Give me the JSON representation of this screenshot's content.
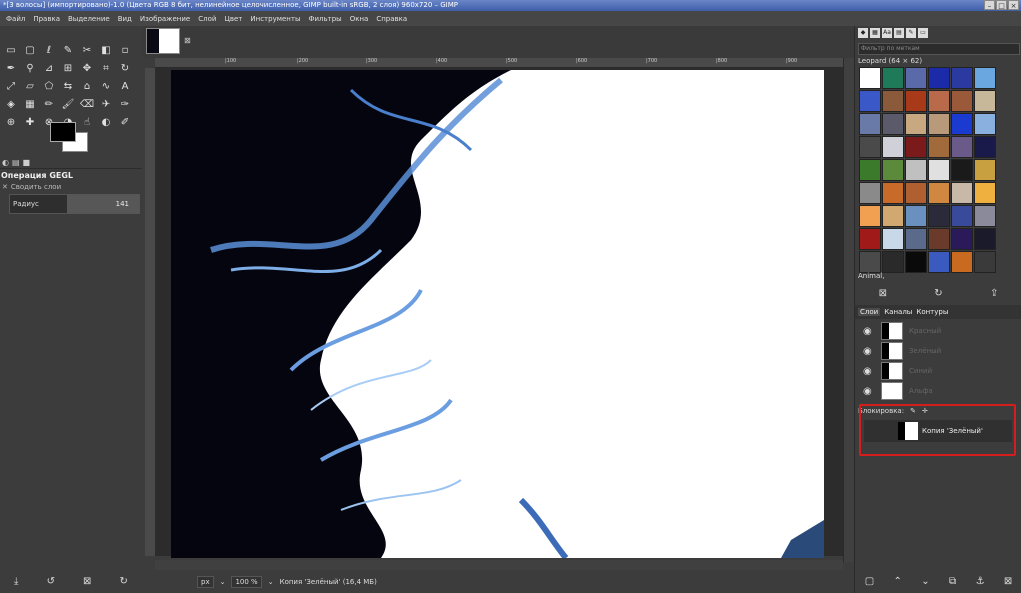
{
  "window": {
    "title": "*[3 волосы] (импортировано)-1.0 (Цвета RGB 8 бит, нелинейное целочисленное, GIMP built-in sRGB, 2 слоя) 960x720 – GIMP"
  },
  "menu": [
    "Файл",
    "Правка",
    "Выделение",
    "Вид",
    "Изображение",
    "Слой",
    "Цвет",
    "Инструменты",
    "Фильтры",
    "Окна",
    "Справка"
  ],
  "tool_options": {
    "title": "Операция GEGL",
    "subtitle": "Сводить слои",
    "radius_label": "Радиус",
    "radius_value": "141"
  },
  "ruler": [
    "|100",
    "|200",
    "|300",
    "|400",
    "|500",
    "|600",
    "|700",
    "|800",
    "|900"
  ],
  "status": {
    "unit": "px",
    "zoom": "100 %",
    "layer_info": "Копия 'Зелёный' (16,4 МБ)"
  },
  "patterns": {
    "filter_placeholder": "Фильтр по меткам",
    "current": "Leopard (64 × 62)",
    "footer": "Animal,"
  },
  "dock_tabs": [
    "Слои",
    "Каналы",
    "Контуры"
  ],
  "layers": [
    {
      "name": "Красный"
    },
    {
      "name": "Зелёный"
    },
    {
      "name": "Синий"
    },
    {
      "name": "Альфа"
    }
  ],
  "lock_label": "Блокировка:",
  "selected_layer": {
    "name": "Копия 'Зелёный'"
  },
  "colors": {
    "highlight": "#d41e1e",
    "canvas_bg": "#ffffff",
    "ui_bg": "#3c3c3c"
  }
}
